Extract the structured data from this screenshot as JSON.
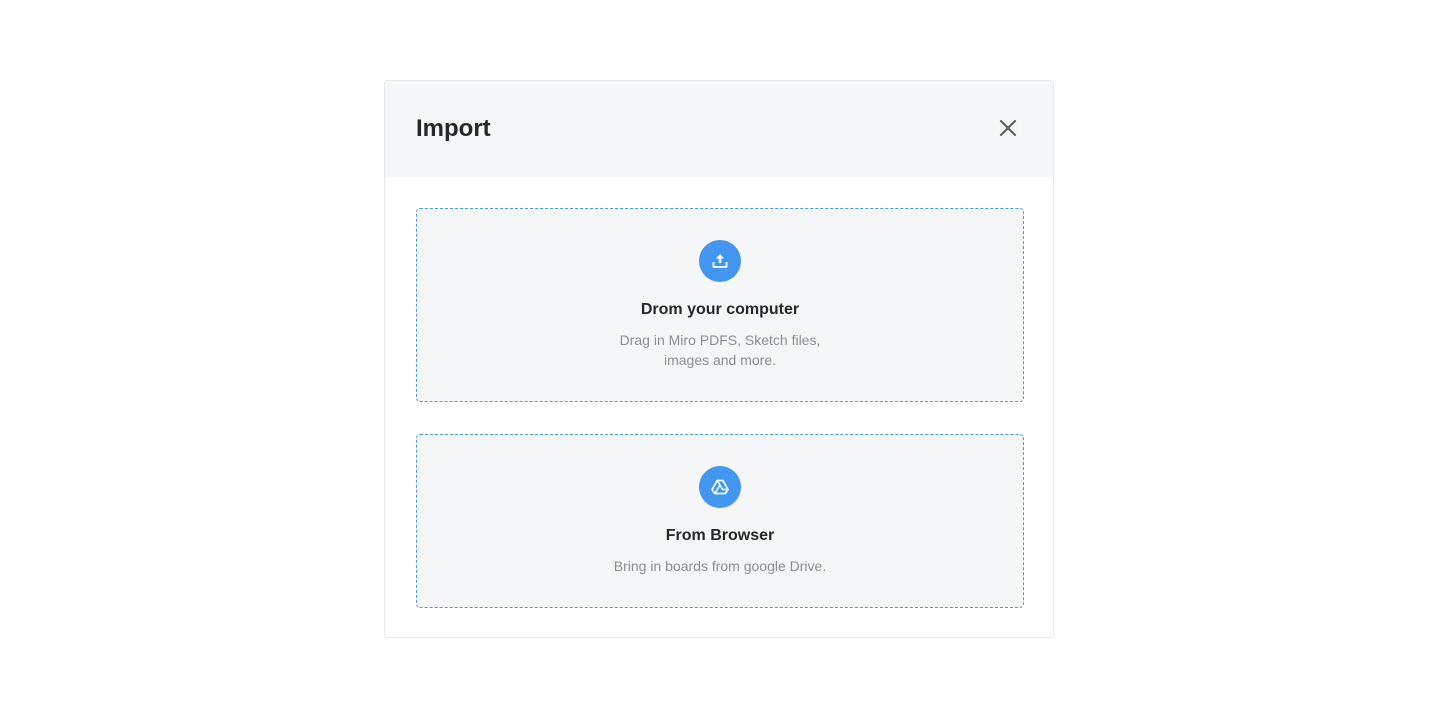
{
  "modal": {
    "title": "Import",
    "close_icon": "close-icon"
  },
  "options": {
    "computer": {
      "icon": "upload-icon",
      "title": "Drom your computer",
      "desc_line1": "Drag in Miro PDFS, Sketch files,",
      "desc_line2": "images and more."
    },
    "browser": {
      "icon": "google-drive-icon",
      "title": "From Browser",
      "desc_line1": "Bring in boards from google Drive."
    }
  },
  "colors": {
    "accent": "#4296ef",
    "dashed_border": "#4a9fde",
    "header_bg": "#f5f6f8",
    "title_text": "#25272b",
    "muted_text": "#8a8d93"
  }
}
